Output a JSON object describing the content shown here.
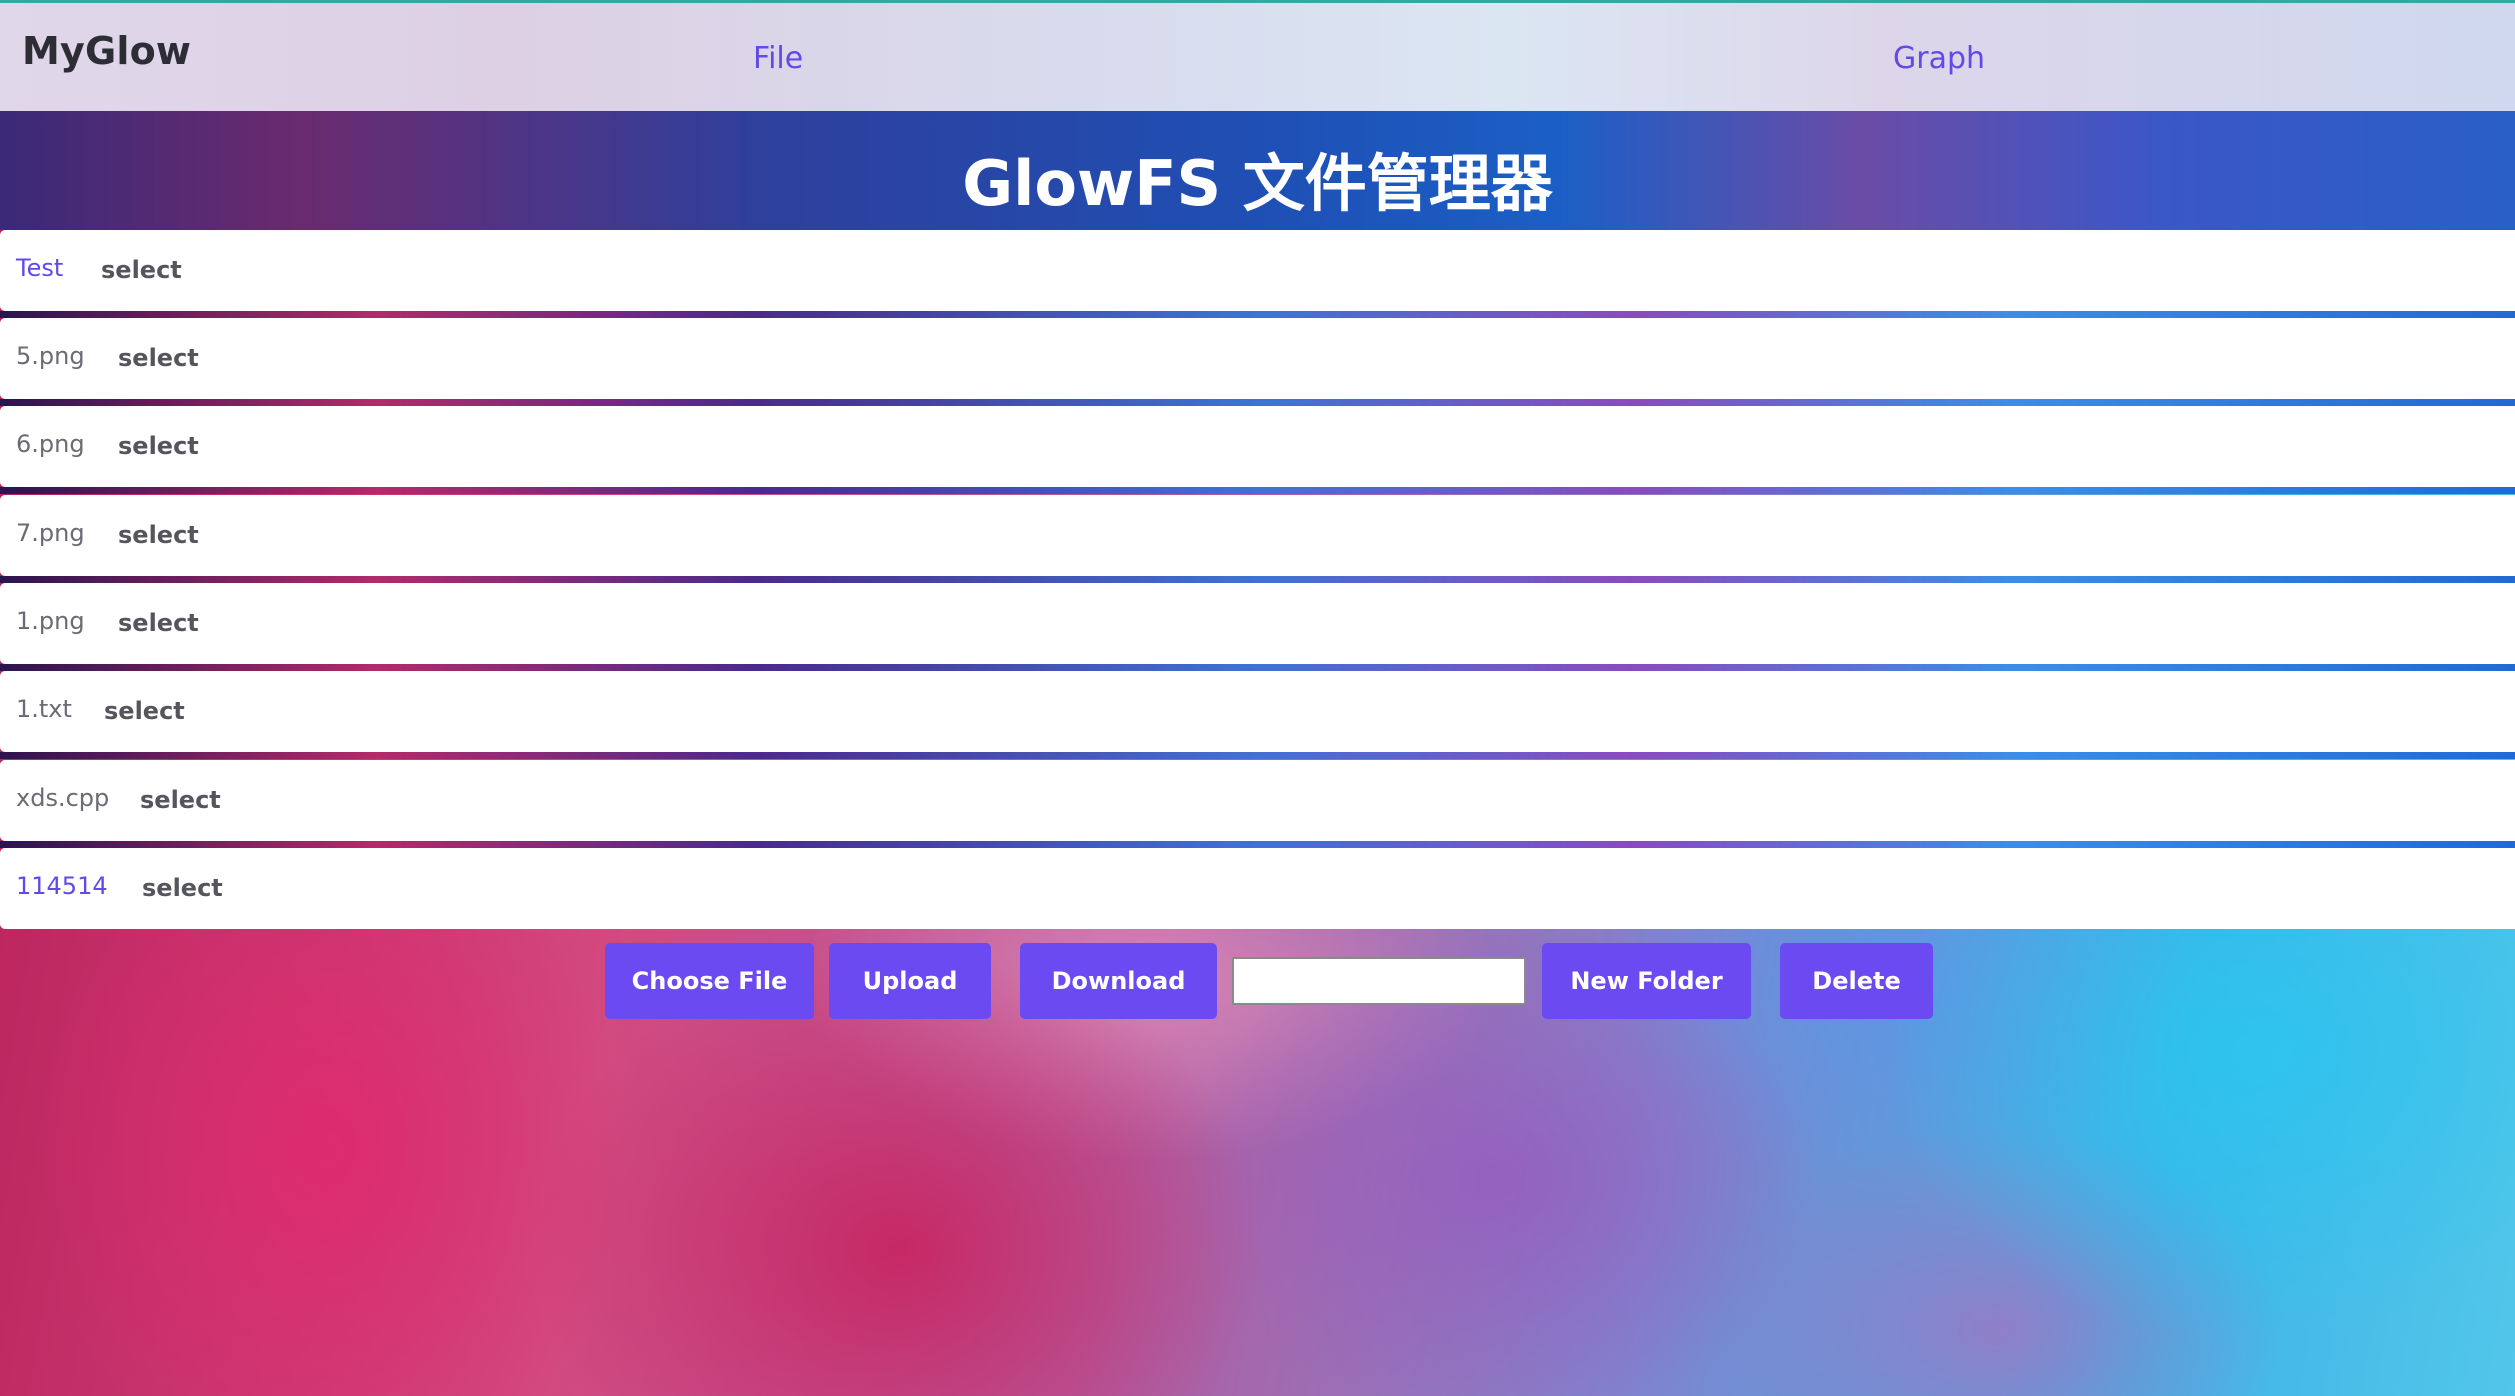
{
  "navbar": {
    "brand": "MyGlow",
    "links": [
      {
        "label": "File"
      },
      {
        "label": "Graph"
      }
    ]
  },
  "page": {
    "title": "GlowFS 文件管理器"
  },
  "files": [
    {
      "name": "Test",
      "type": "folder",
      "select_label": "select"
    },
    {
      "name": "5.png",
      "type": "file",
      "select_label": "select"
    },
    {
      "name": "6.png",
      "type": "file",
      "select_label": "select"
    },
    {
      "name": "7.png",
      "type": "file",
      "select_label": "select"
    },
    {
      "name": "1.png",
      "type": "file",
      "select_label": "select"
    },
    {
      "name": "1.txt",
      "type": "file",
      "select_label": "select"
    },
    {
      "name": "xds.cpp",
      "type": "file",
      "select_label": "select"
    },
    {
      "name": "114514",
      "type": "folder",
      "select_label": "select"
    }
  ],
  "actions": {
    "choose_file": "Choose File",
    "upload": "Upload",
    "download": "Download",
    "folder_name_value": "",
    "new_folder": "New Folder",
    "delete": "Delete"
  },
  "colors": {
    "accent": "#6b4af2",
    "link": "#6448e8",
    "navbar_top_border": "#36a6a0"
  }
}
